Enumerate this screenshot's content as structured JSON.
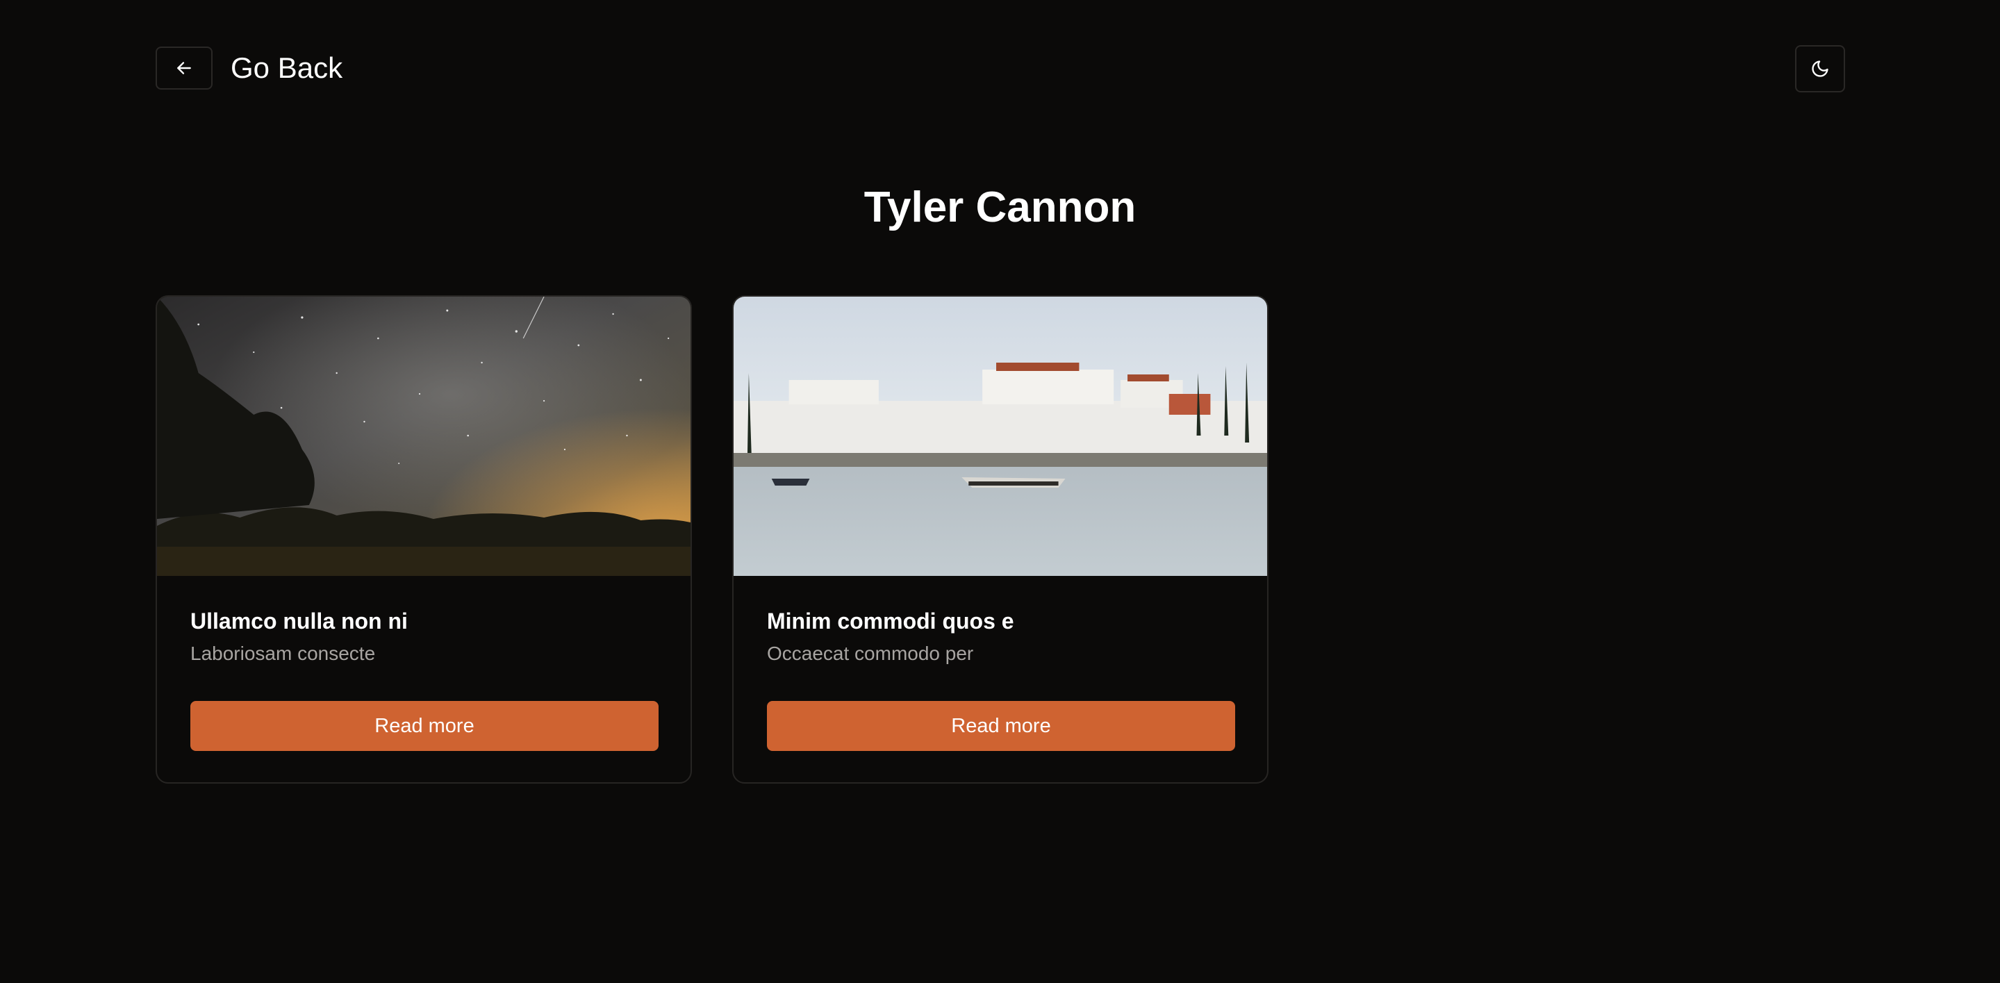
{
  "header": {
    "back_label": "Go Back",
    "back_icon": "arrow-left-icon",
    "theme_icon": "moon-icon"
  },
  "page": {
    "title": "Tyler Cannon"
  },
  "cards": [
    {
      "title": "Ullamco nulla non ni",
      "description": "Laboriosam consecte",
      "button_label": "Read more",
      "image": "night-sky-milky-way-over-trees"
    },
    {
      "title": "Minim commodi quos e",
      "description": "Occaecat commodo per",
      "button_label": "Read more",
      "image": "white-coastal-castle-with-boats"
    }
  ],
  "colors": {
    "background": "#0b0a09",
    "accent": "#cf6331",
    "muted_text": "#a8a5a2",
    "border": "#272523"
  }
}
